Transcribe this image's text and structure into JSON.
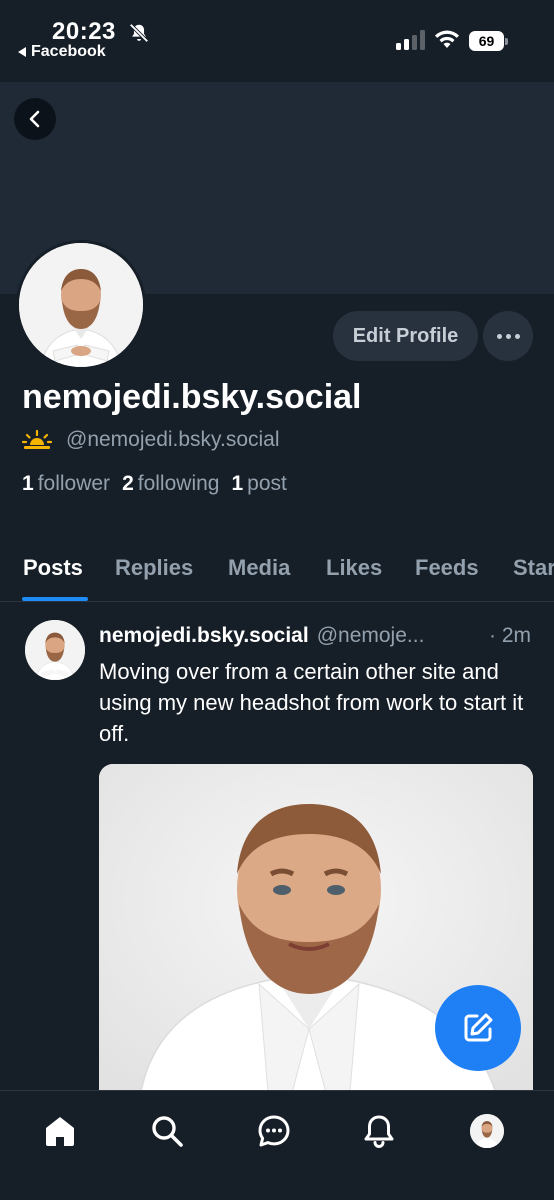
{
  "status_bar": {
    "time": "20:23",
    "back_app": "Facebook",
    "battery": "69"
  },
  "profile": {
    "display_name": "nemojedi.bsky.social",
    "handle": "@nemojedi.bsky.social",
    "edit_label": "Edit Profile",
    "followers_count": "1",
    "followers_label": "follower",
    "following_count": "2",
    "following_label": "following",
    "posts_count": "1",
    "posts_label": "post"
  },
  "tabs": [
    {
      "label": "Posts",
      "active": true
    },
    {
      "label": "Replies"
    },
    {
      "label": "Media"
    },
    {
      "label": "Likes"
    },
    {
      "label": "Feeds"
    },
    {
      "label": "Starter Packs"
    }
  ],
  "post": {
    "author_name": "nemojedi.bsky.social",
    "author_handle": "@nemoje...",
    "time": "· 2m",
    "text": "Moving over from a certain other site and using my new headshot from work to start it off."
  },
  "colors": {
    "background": "#161e27",
    "banner": "#1f2a36",
    "accent": "#1d8cf8",
    "fab": "#1f7ff5",
    "muted_text": "#93a0ad"
  },
  "icons": {
    "back": "chevron-left-icon",
    "compose": "compose-icon",
    "home": "home-icon",
    "search": "search-icon",
    "chat": "chat-icon",
    "notifications": "bell-icon"
  }
}
